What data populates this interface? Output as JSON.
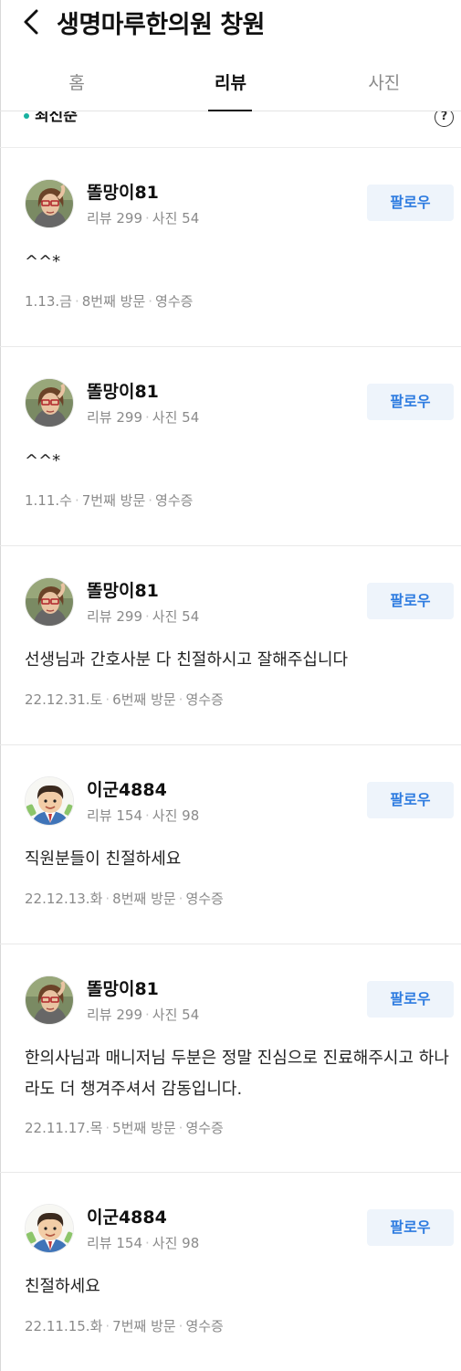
{
  "header": {
    "title": "생명마루한의원 창원"
  },
  "tabs": [
    {
      "label": "홈"
    },
    {
      "label": "리뷰"
    },
    {
      "label": "사진"
    }
  ],
  "sort": {
    "label": "최신순"
  },
  "help": {
    "label": "?"
  },
  "reviews": [
    {
      "nickname": "똘망이81",
      "stat_reviews": "리뷰 299",
      "stat_photos": "사진 54",
      "follow": "팔로우",
      "text": "^^*",
      "date": "1.13.금",
      "visit": "8번째 방문",
      "receipt": "영수증"
    },
    {
      "nickname": "똘망이81",
      "stat_reviews": "리뷰 299",
      "stat_photos": "사진 54",
      "follow": "팔로우",
      "text": "^^*",
      "date": "1.11.수",
      "visit": "7번째 방문",
      "receipt": "영수증"
    },
    {
      "nickname": "똘망이81",
      "stat_reviews": "리뷰 299",
      "stat_photos": "사진 54",
      "follow": "팔로우",
      "text": "선생님과 간호사분 다 친절하시고 잘해주십니다",
      "date": "22.12.31.토",
      "visit": "6번째 방문",
      "receipt": "영수증"
    },
    {
      "nickname": "이군4884",
      "stat_reviews": "리뷰 154",
      "stat_photos": "사진 98",
      "follow": "팔로우",
      "text": "직원분들이 친절하세요",
      "date": "22.12.13.화",
      "visit": "8번째 방문",
      "receipt": "영수증"
    },
    {
      "nickname": "똘망이81",
      "stat_reviews": "리뷰 299",
      "stat_photos": "사진 54",
      "follow": "팔로우",
      "text": "한의사님과 매니저님 두분은 정말 진심으로 진료해주시고 하나라도 더 챙겨주셔서 감동입니다.",
      "date": "22.11.17.목",
      "visit": "5번째 방문",
      "receipt": "영수증"
    },
    {
      "nickname": "이군4884",
      "stat_reviews": "리뷰 154",
      "stat_photos": "사진 98",
      "follow": "팔로우",
      "text": "친절하세요",
      "date": "22.11.15.화",
      "visit": "7번째 방문",
      "receipt": "영수증"
    }
  ],
  "colors": {
    "accent_blue": "#2d7be0",
    "follow_bg": "#eef4fb",
    "sort_dot": "#18b1a0"
  },
  "icons": {
    "back": "chevron-left-icon",
    "help": "question-circle-icon"
  }
}
